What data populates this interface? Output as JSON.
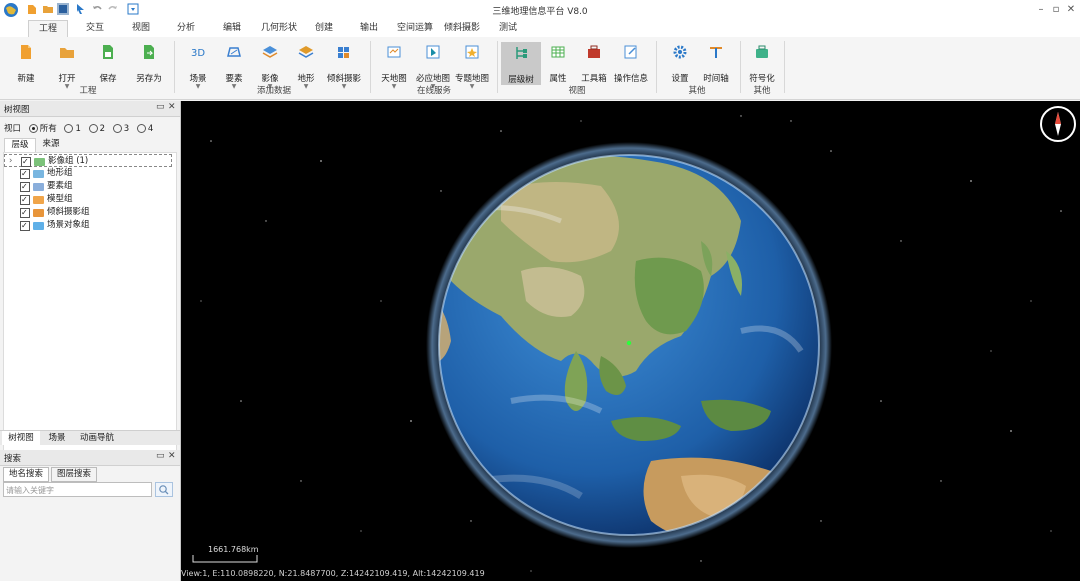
{
  "window": {
    "title": "三维地理信息平台 V8.0"
  },
  "tabs": [
    "工程",
    "交互",
    "视图",
    "分析",
    "编辑",
    "几何形状",
    "创建",
    "输出",
    "空间运算",
    "倾斜摄影",
    "测试"
  ],
  "ribbon": {
    "buttons": [
      "新建",
      "打开",
      "保存",
      "另存为",
      "场景",
      "要素",
      "影像",
      "地形",
      "倾斜摄影",
      "天地图",
      "必应地图",
      "专题地图",
      "层级树",
      "属性",
      "工具箱",
      "操作信息",
      "设置",
      "时间轴",
      "符号化"
    ],
    "groups": [
      "工程",
      "添加数据",
      "在线服务",
      "视图",
      "其他",
      "其他"
    ]
  },
  "tree_panel": {
    "title": "树视图",
    "view_label": "视口",
    "radios": [
      "所有",
      "1",
      "2",
      "3",
      "4"
    ],
    "subtabs": [
      "层级",
      "来源"
    ],
    "items": [
      "影像组 (1)",
      "地形组",
      "要素组",
      "模型组",
      "倾斜摄影组",
      "场景对象组"
    ],
    "bottom_tabs": [
      "树视图",
      "场景",
      "动画导航"
    ]
  },
  "search_panel": {
    "title": "搜索",
    "tabs": [
      "地名搜索",
      "图层搜索"
    ],
    "placeholder": "请输入关键字"
  },
  "scene": {
    "scale_label": "1661.768km",
    "status": "View:1, E:110.0898220, N:21.8487700, Z:14242109.419, Alt:14242109.419"
  },
  "colors": {
    "space": "#000000",
    "ocean": "#1f66b0",
    "land": "#9aa86c",
    "accent": "#1a6fd1"
  }
}
